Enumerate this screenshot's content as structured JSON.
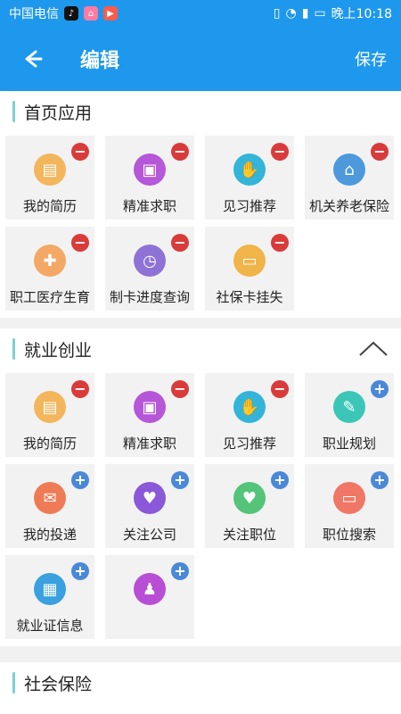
{
  "status": {
    "carrier": "中国电信",
    "time": "晚上10:18"
  },
  "header": {
    "title": "编辑",
    "save_label": "保存"
  },
  "sections": [
    {
      "title": "首页应用",
      "items": [
        {
          "label": "我的简历",
          "icon": "resume-icon",
          "action": "remove"
        },
        {
          "label": "精准求职",
          "icon": "briefcase-icon",
          "action": "remove"
        },
        {
          "label": "见习推荐",
          "icon": "hand-icon",
          "action": "remove"
        },
        {
          "label": "机关养老保险",
          "icon": "building-icon",
          "action": "remove"
        },
        {
          "label": "职工医疗生育",
          "icon": "medical-icon",
          "action": "remove"
        },
        {
          "label": "制卡进度查询",
          "icon": "clock-icon",
          "action": "remove"
        },
        {
          "label": "社保卡挂失",
          "icon": "card-icon",
          "action": "remove"
        }
      ]
    },
    {
      "title": "就业创业",
      "items": [
        {
          "label": "我的简历",
          "icon": "resume-icon",
          "action": "remove"
        },
        {
          "label": "精准求职",
          "icon": "briefcase-icon",
          "action": "remove"
        },
        {
          "label": "见习推荐",
          "icon": "hand-icon",
          "action": "remove"
        },
        {
          "label": "职业规划",
          "icon": "tools-icon",
          "action": "add"
        },
        {
          "label": "我的投递",
          "icon": "send-icon",
          "action": "add"
        },
        {
          "label": "关注公司",
          "icon": "heart-company-icon",
          "action": "add"
        },
        {
          "label": "关注职位",
          "icon": "heart-icon",
          "action": "add"
        },
        {
          "label": "职位搜索",
          "icon": "monitor-icon",
          "action": "add"
        },
        {
          "label": "就业证信息",
          "icon": "id-card-icon",
          "action": "add"
        },
        {
          "label": "",
          "icon": "people-icon",
          "action": "add"
        }
      ]
    },
    {
      "title": "社会保险",
      "items": []
    }
  ],
  "colors": {
    "brand": "#1e98ec",
    "remove": "#d93b3b",
    "add": "#4b88d8"
  }
}
